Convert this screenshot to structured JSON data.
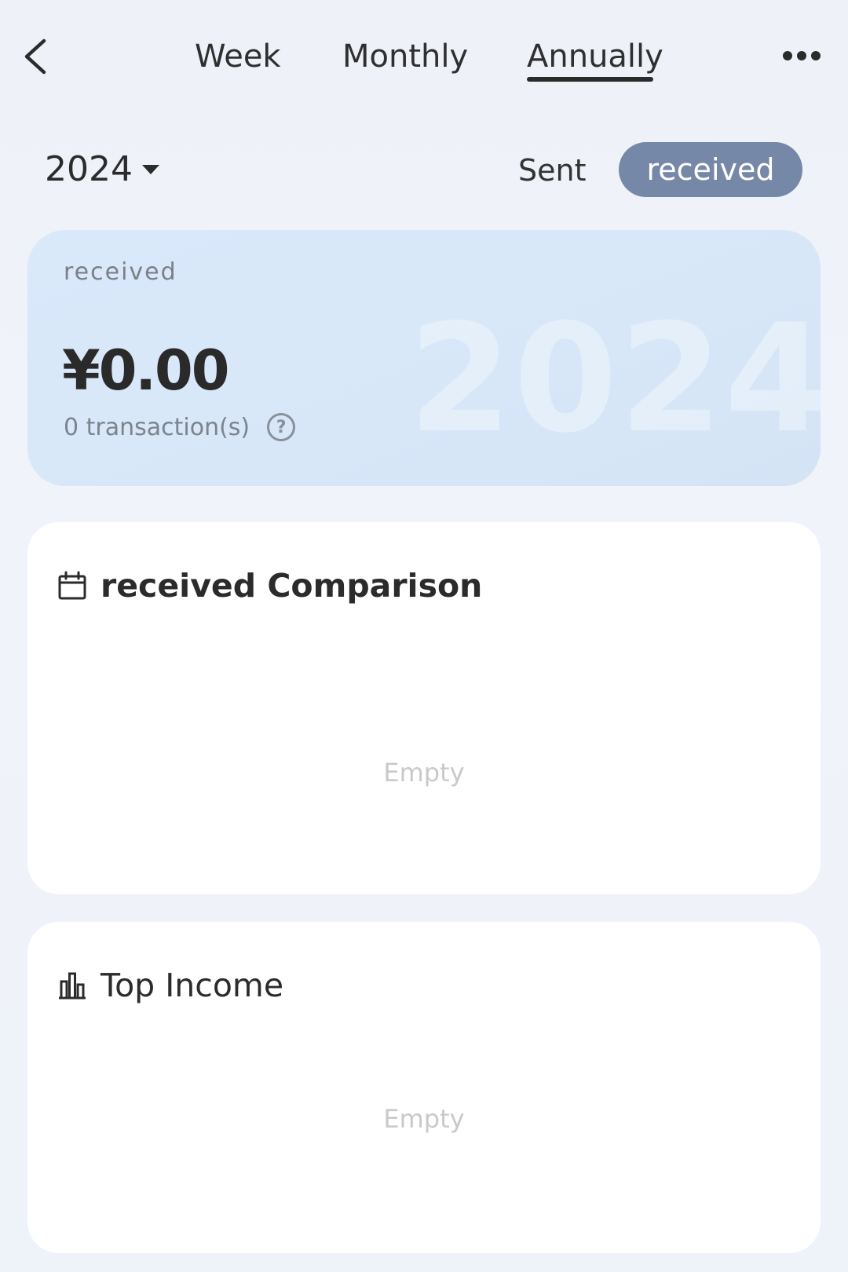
{
  "nav": {
    "tabs": [
      {
        "label": "Week"
      },
      {
        "label": "Monthly"
      },
      {
        "label": "Annually"
      }
    ],
    "active_tab": "Annually"
  },
  "filter": {
    "year": "2024",
    "toggle": {
      "sent_label": "Sent",
      "received_label": "received",
      "active": "received"
    }
  },
  "summary": {
    "label": "received",
    "amount": "¥0.00",
    "count": "0 transaction(s)",
    "watermark_year": "2024"
  },
  "comparison_card": {
    "title": "received Comparison",
    "empty_text": "Empty"
  },
  "top_income_card": {
    "title": "Top Income",
    "empty_text": "Empty"
  },
  "colors": {
    "toggle_active_bg": "#7688a8",
    "summary_card_bg": "#d9e9fa",
    "empty_text": "#c9c9c9"
  },
  "icons": {
    "back": "chevron-left-icon",
    "more": "more-horizontal-icon",
    "year_dropdown": "caret-down-icon",
    "help": "help-circle-icon",
    "comparison": "calendar-icon",
    "top_income": "bar-chart-icon"
  }
}
